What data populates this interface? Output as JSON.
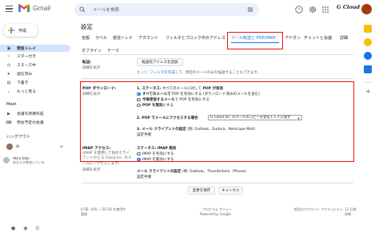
{
  "app": {
    "name": "Gmail",
    "brand_text": "G Cloud",
    "search_placeholder": "メールを検索"
  },
  "icons": {
    "menu": "menu-icon",
    "search": "search-icon",
    "tune": "search-options-icon",
    "help": "help-icon",
    "settings": "gear-icon",
    "apps": "apps-grid-icon"
  },
  "sidebar": {
    "compose_label": "作成",
    "items": [
      {
        "label": "受信トレイ",
        "icon": "inbox-icon",
        "active": true
      },
      {
        "label": "スター付き",
        "icon": "star-icon"
      },
      {
        "label": "スヌーズ中",
        "icon": "clock-icon"
      },
      {
        "label": "送信済み",
        "icon": "send-icon"
      },
      {
        "label": "下書き",
        "icon": "draft-icon"
      },
      {
        "label": "もっと見る",
        "icon": "chevron-down-icon"
      }
    ],
    "meet_title": "Meet",
    "meet_items": [
      {
        "label": "会議を新規作成",
        "icon": "video-icon"
      },
      {
        "label": "参加予定の会議",
        "icon": "keyboard-icon"
      }
    ],
    "hangouts_title": "ハングアウト",
    "hangouts_user": "Ai",
    "hangouts_add": "+",
    "akira": "Akira Sato",
    "akira_sub": "あなたが参加している"
  },
  "main": {
    "title": "設定",
    "tabs_row1": [
      "全般",
      "ラベル",
      "受信トレイ",
      "アカウント",
      "フィルタとブロック中のアドレス",
      "メール転送と POP/IMAP",
      "アドオン",
      "チャットと会議",
      "詳細"
    ],
    "active_tab": "メール転送と POP/IMAP",
    "tabs_row2": [
      "オフライン",
      "テーマ"
    ],
    "forwarding": {
      "label": "転送:",
      "learn_more": "詳細を表示",
      "button": "転送先アドレスを追加",
      "hint_prefix": "ヒント: ",
      "hint_link": "フィルタを作成",
      "hint_suffix": "して、特定のメールのみを転送することもできます。"
    },
    "pop": {
      "label": "POP ダウンロード:",
      "learn_more": "詳細を表示",
      "status_num": "1. ステータス:",
      "status_text": "すべてのメールに対して",
      "status_strong": "POP が有効",
      "options": [
        {
          "strong": "すべてのメールで",
          "rest": " POP を有効にする (ダウンロード済みのメールを含む)",
          "checked": true
        },
        {
          "strong": "今後受信するメール",
          "rest": "で POP を有効にする",
          "checked": false
        },
        {
          "strong": "POP を無効",
          "rest": "にする",
          "checked": false
        }
      ],
      "step2_label": "2. POP でメールにアクセスする場合",
      "step2_select": "G Cloud Inc. のメールのコピーを受信トレイに残す",
      "step3_label": "3. メール クライアントの設定",
      "step3_rest": " (例: Outlook、Eudora、Netscape Mail)",
      "step3_link": "設定手順"
    },
    "imap": {
      "label": "IMAP アクセス:",
      "sub": "(IMAP を使用して他のクライアントから G Cloud Inc. のメールにアクセスします)",
      "learn_more": "詳細を表示",
      "status": "ステータス: IMAP 無効",
      "options": [
        {
          "label": "IMAP を有効にする",
          "checked": false
        },
        {
          "label": "IMAP を無効にする",
          "checked": true
        }
      ],
      "client_label": "メール クライアントの設定",
      "client_rest": " (例: Outlook、Thunderbird、iPhone)",
      "client_link": "設定手順"
    },
    "save_button": "変更を保存",
    "cancel_button": "キャンセル",
    "footer": {
      "storage": "0 GB（0%）/ 30 GB を使用中",
      "manage": "管理",
      "policy": "プログラム ポリシー",
      "powered": "Powered by Google",
      "activity": "前回のアカウント アクティビティ: 12 日前",
      "details": "詳細"
    }
  },
  "colors": {
    "accent": "#1a73e8",
    "highlight_border": "#ee1111",
    "active_nav": "#d3e3fd"
  }
}
